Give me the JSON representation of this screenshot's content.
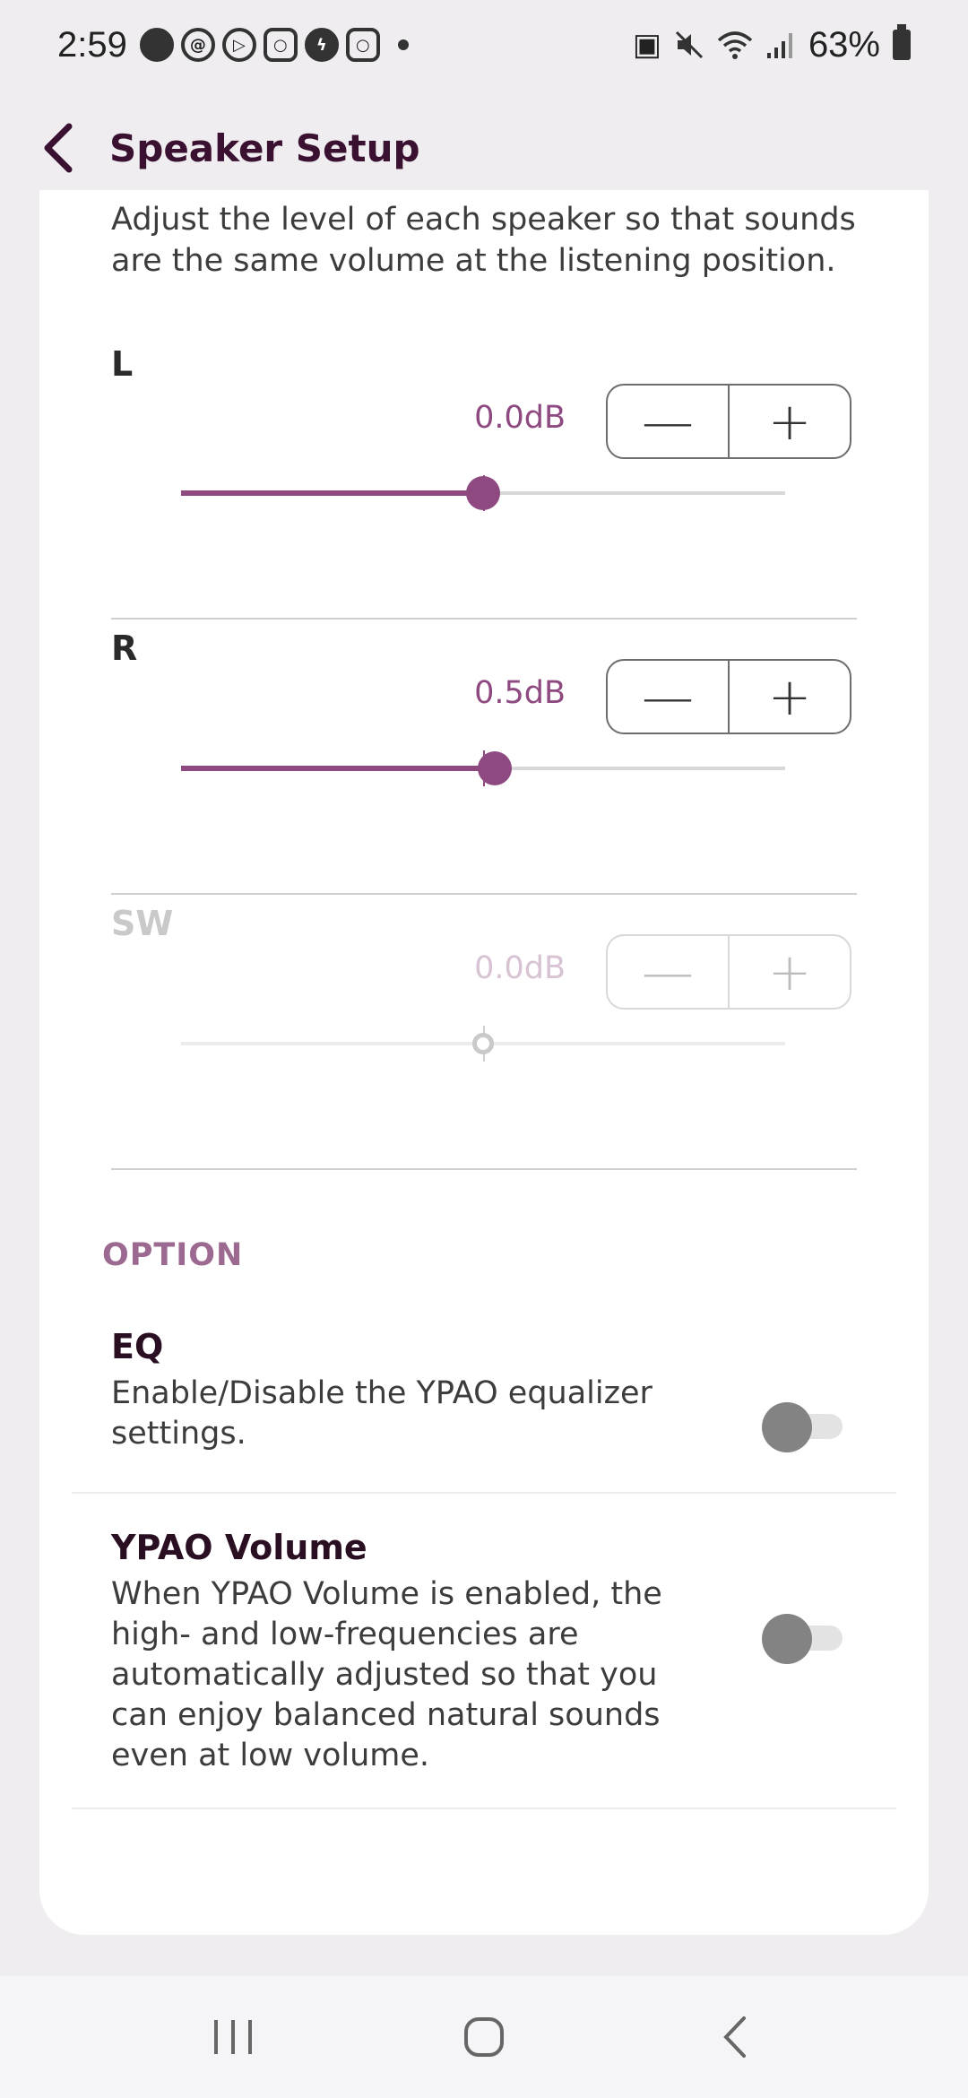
{
  "status_bar": {
    "time": "2:59",
    "notification_icons": [
      "chat-bubble-icon",
      "threads-icon",
      "play-circle-icon",
      "instagram-icon",
      "messenger-icon",
      "instagram-icon"
    ],
    "battery_percent": "63%"
  },
  "header": {
    "title": "Speaker Setup"
  },
  "description": "Adjust the level of each speaker so that sounds are the same volume at the listening position.",
  "channels": [
    {
      "label": "L",
      "value": "0.0dB",
      "minus": "—",
      "plus": "+",
      "slider_level": 0.5,
      "enabled": true
    },
    {
      "label": "R",
      "value": "0.5dB",
      "minus": "—",
      "plus": "+",
      "slider_level": 0.52,
      "enabled": true
    },
    {
      "label": "SW",
      "value": "0.0dB",
      "minus": "—",
      "plus": "+",
      "slider_level": 0.5,
      "enabled": false
    }
  ],
  "options": {
    "header": "OPTION",
    "eq": {
      "title": "EQ",
      "description": "Enable/Disable the YPAO equalizer settings.",
      "enabled": false
    },
    "ypao_volume": {
      "title": "YPAO Volume",
      "description": "When YPAO Volume is enabled, the high- and low-frequencies are automatically adjusted so that you can enjoy balanced natural sounds even at low volume.",
      "enabled": false
    }
  },
  "colors": {
    "accent": "#8e4a80",
    "title": "#3a1130",
    "option_header": "#9c6a90"
  }
}
